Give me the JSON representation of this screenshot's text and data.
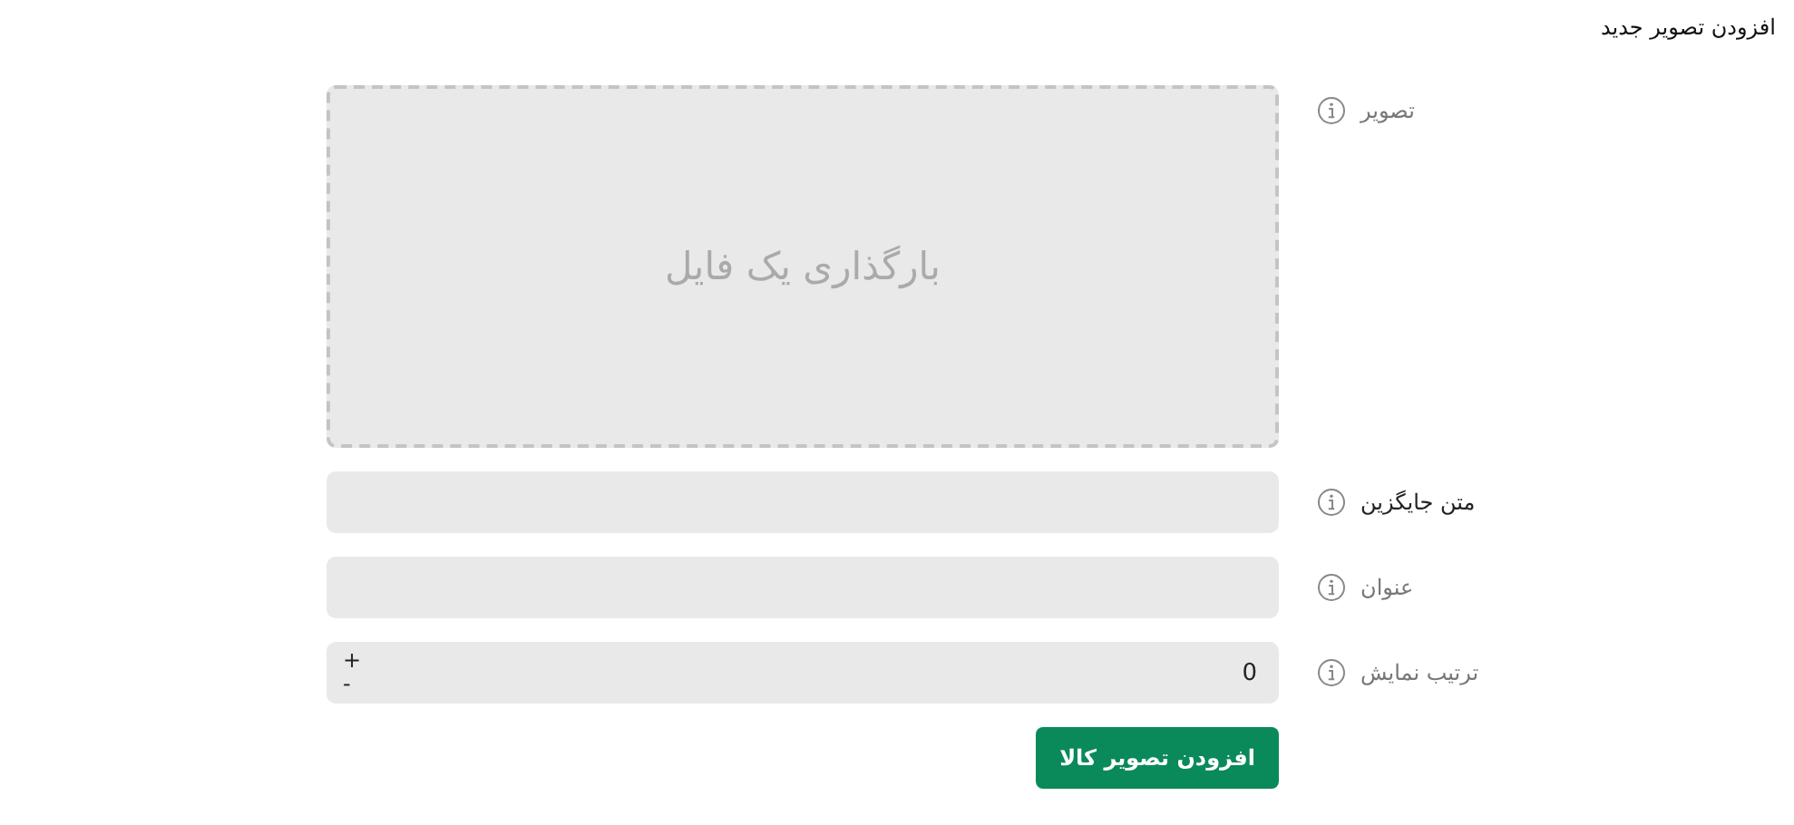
{
  "title": "افزودن تصویر جدید",
  "fields": [
    {
      "kind": "upload",
      "label": "تصویر",
      "highlighted": false,
      "prompt": "بارگذاری یک فایل"
    },
    {
      "kind": "text",
      "label": "متن جایگزین",
      "highlighted": true
    },
    {
      "kind": "text",
      "label": "عنوان",
      "highlighted": false
    },
    {
      "kind": "number",
      "label": "ترتیب نمایش",
      "highlighted": false,
      "value": "0",
      "increment": "+",
      "decrement": "-"
    }
  ],
  "submit": "افزودن تصویر کالا"
}
